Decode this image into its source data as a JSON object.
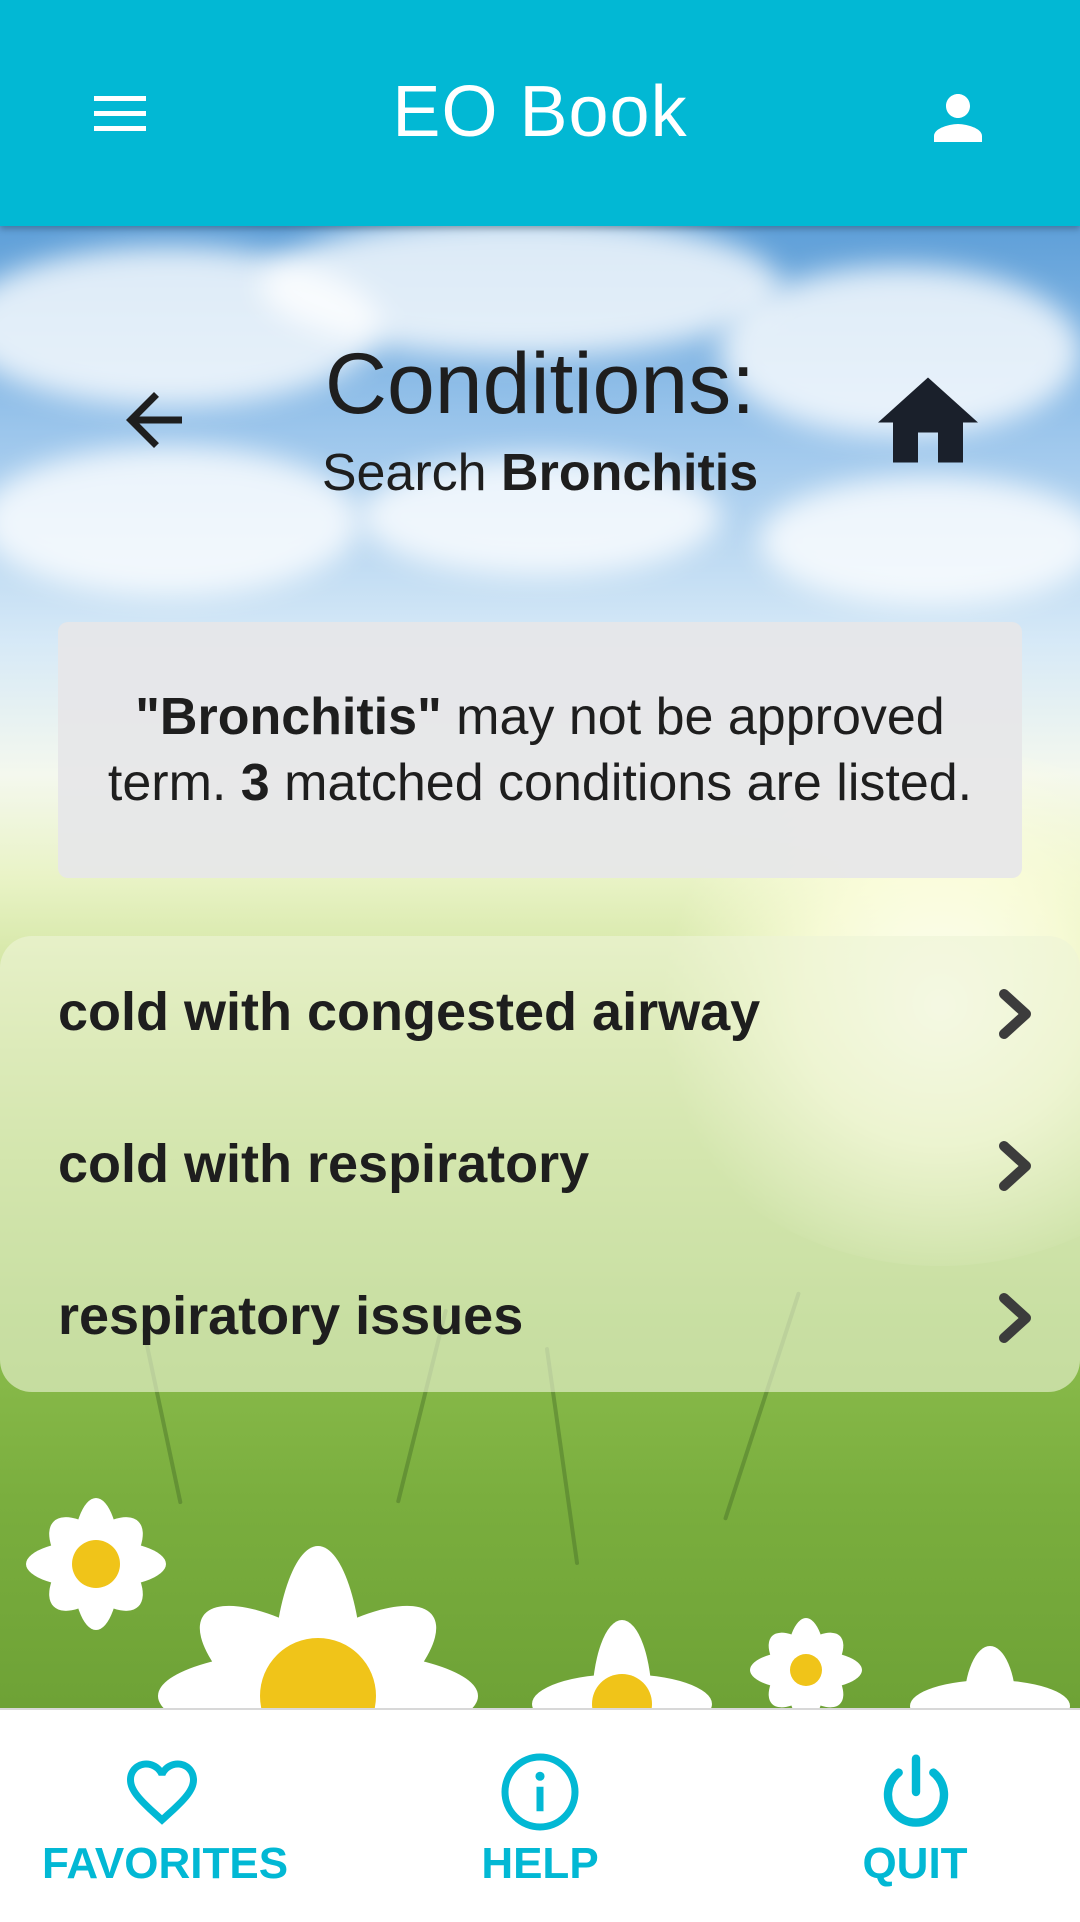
{
  "app": {
    "title": "EO Book",
    "accent_color": "#02b8d4",
    "menu_icon": "menu-icon",
    "account_icon": "account-icon"
  },
  "header": {
    "title": "Conditions:",
    "subtitle_prefix": "Search ",
    "search_term": "Bronchitis",
    "back_icon": "arrow-left-icon",
    "home_icon": "home-icon"
  },
  "info": {
    "quote_open": "\"",
    "term": "Bronchitis",
    "quote_close": "\"",
    "text_part1": " may not be approved term. ",
    "count": "3",
    "text_part2": " matched conditions are listed."
  },
  "conditions": [
    {
      "label": "cold with congested airway",
      "icon": "chevron-right-icon"
    },
    {
      "label": "cold with respiratory",
      "icon": "chevron-right-icon"
    },
    {
      "label": "respiratory issues",
      "icon": "chevron-right-icon"
    }
  ],
  "bottom_nav": [
    {
      "label": "FAVORITES",
      "icon": "heart-icon"
    },
    {
      "label": "HELP",
      "icon": "info-icon"
    },
    {
      "label": "QUIT",
      "icon": "power-icon"
    }
  ]
}
